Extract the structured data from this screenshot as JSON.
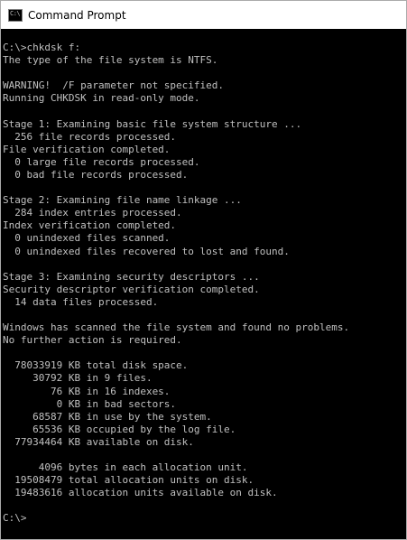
{
  "window": {
    "title": "Command Prompt",
    "icon": "console-app-icon",
    "icon_glyph": "C:\\"
  },
  "console": {
    "lines": [
      "C:\\>chkdsk f:",
      "The type of the file system is NTFS.",
      "",
      "WARNING!  /F parameter not specified.",
      "Running CHKDSK in read-only mode.",
      "",
      "Stage 1: Examining basic file system structure ...",
      "  256 file records processed.",
      "File verification completed.",
      "  0 large file records processed.",
      "  0 bad file records processed.",
      "",
      "Stage 2: Examining file name linkage ...",
      "  284 index entries processed.",
      "Index verification completed.",
      "  0 unindexed files scanned.",
      "  0 unindexed files recovered to lost and found.",
      "",
      "Stage 3: Examining security descriptors ...",
      "Security descriptor verification completed.",
      "  14 data files processed.",
      "",
      "Windows has scanned the file system and found no problems.",
      "No further action is required.",
      "",
      "  78033919 KB total disk space.",
      "     30792 KB in 9 files.",
      "        76 KB in 16 indexes.",
      "         0 KB in bad sectors.",
      "     68587 KB in use by the system.",
      "     65536 KB occupied by the log file.",
      "  77934464 KB available on disk.",
      "",
      "      4096 bytes in each allocation unit.",
      "  19508479 total allocation units on disk.",
      "  19483616 allocation units available on disk.",
      "",
      "C:\\>"
    ],
    "colors": {
      "background": "#000000",
      "text": "#c0c0c0"
    }
  }
}
